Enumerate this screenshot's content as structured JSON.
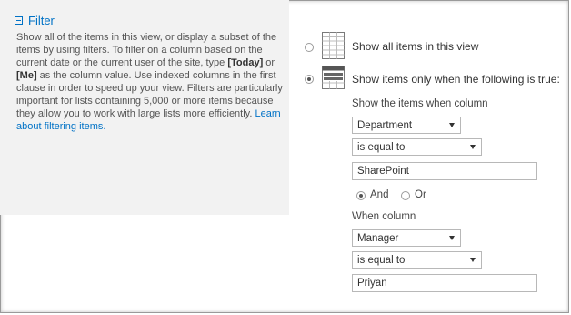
{
  "section": {
    "title": "Filter",
    "desc_1": "Show all of the items in this view, or display a subset of the items by using filters. To filter on a column based on the current date or the current user of the site, type ",
    "token_today": "[Today]",
    "desc_or": " or ",
    "token_me": "[Me]",
    "desc_2": " as the column value. Use indexed columns in the first clause in order to speed up your view. Filters are particularly important for lists containing 5,000 or more items because they allow you to work with large lists more efficiently. ",
    "learn_link": "Learn about filtering items."
  },
  "options": {
    "show_all": "Show all items in this view",
    "show_filtered": "Show items only when the following is true:"
  },
  "filter": {
    "show_when": "Show the items when column",
    "column1": "Department",
    "operator1": "is equal to",
    "value1": "SharePoint",
    "and_label": "And",
    "or_label": "Or",
    "when_column": "When column",
    "column2": "Manager",
    "operator2": "is equal to",
    "value2": "Priyan"
  },
  "icons": {
    "collapse": "minus-box-icon",
    "all_items": "grid-icon",
    "filtered_items": "filtered-grid-icon"
  },
  "colors": {
    "link": "#0072c6",
    "panel": "#f2f2f2"
  }
}
